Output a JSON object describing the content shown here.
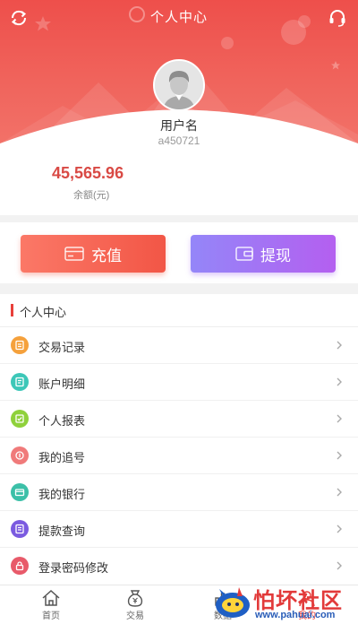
{
  "header": {
    "title": "个人中心",
    "username": "用户名",
    "user_id": "a450721"
  },
  "account": {
    "balance": "45,565.96",
    "balance_label": "余额(元)"
  },
  "actions": {
    "recharge_label": "充值",
    "withdraw_label": "提现"
  },
  "section": {
    "title": "个人中心",
    "items": [
      {
        "label": "交易记录",
        "icon": "trade-record-icon",
        "color": "#f5a13c"
      },
      {
        "label": "账户明细",
        "icon": "account-detail-icon",
        "color": "#3cc7b8"
      },
      {
        "label": "个人报表",
        "icon": "report-icon",
        "color": "#8fd13b"
      },
      {
        "label": "我的追号",
        "icon": "chase-number-icon",
        "color": "#f07a7a"
      },
      {
        "label": "我的银行",
        "icon": "bank-card-icon",
        "color": "#3cc0a8"
      },
      {
        "label": "提款查询",
        "icon": "withdraw-query-icon",
        "color": "#7b5be0"
      },
      {
        "label": "登录密码修改",
        "icon": "lock-icon",
        "color": "#e85a6a"
      }
    ]
  },
  "tabbar": {
    "tabs": [
      {
        "label": "首页",
        "icon": "home-icon"
      },
      {
        "label": "交易",
        "icon": "money-bag-icon"
      },
      {
        "label": "数据",
        "icon": "chart-icon"
      },
      {
        "label": "我的",
        "icon": "user-icon"
      }
    ]
  },
  "watermark": {
    "text": "怕坏社区",
    "url": "www.pahuai.com"
  },
  "colors": {
    "header_red": "#ee4f4b",
    "accent_red": "#d94a45",
    "withdraw_purple": "#a070f0"
  }
}
